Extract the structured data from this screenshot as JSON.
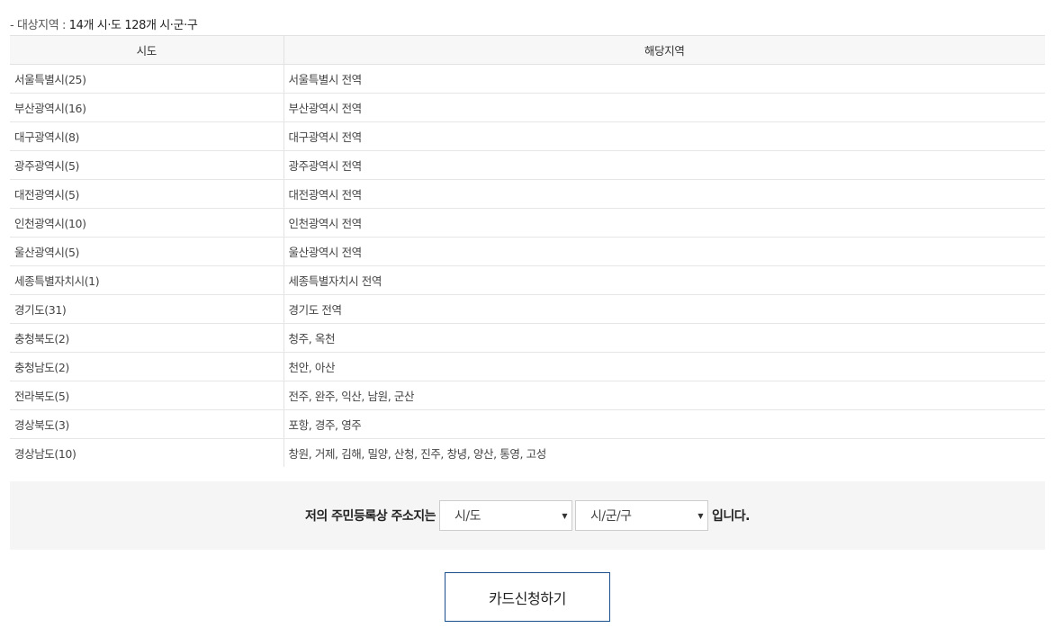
{
  "target": {
    "prefix": "- 대상지역 : ",
    "summary": "14개 시·도 128개 시·군·구"
  },
  "table": {
    "headers": [
      "시도",
      "해당지역"
    ],
    "rows": [
      [
        "서울특별시(25)",
        "서울특별시 전역"
      ],
      [
        "부산광역시(16)",
        "부산광역시 전역"
      ],
      [
        "대구광역시(8)",
        "대구광역시 전역"
      ],
      [
        "광주광역시(5)",
        "광주광역시 전역"
      ],
      [
        "대전광역시(5)",
        "대전광역시 전역"
      ],
      [
        "인천광역시(10)",
        "인천광역시 전역"
      ],
      [
        "울산광역시(5)",
        "울산광역시 전역"
      ],
      [
        "세종특별자치시(1)",
        "세종특별자치시 전역"
      ],
      [
        "경기도(31)",
        "경기도 전역"
      ],
      [
        "충청북도(2)",
        "청주, 옥천"
      ],
      [
        "충청남도(2)",
        "천안, 아산"
      ],
      [
        "전라북도(5)",
        "전주, 완주, 익산, 남원, 군산"
      ],
      [
        "경상북도(3)",
        "포항, 경주, 영주"
      ],
      [
        "경상남도(10)",
        "창원, 거제, 김해, 밀양, 산청, 진주, 창녕, 양산, 통영, 고성"
      ]
    ]
  },
  "address": {
    "lead": "저의 주민등록상 주소지는",
    "sido_select": "시/도",
    "sigungu_select": "시/군/구",
    "tail": "입니다."
  },
  "apply_button": "카드신청하기"
}
